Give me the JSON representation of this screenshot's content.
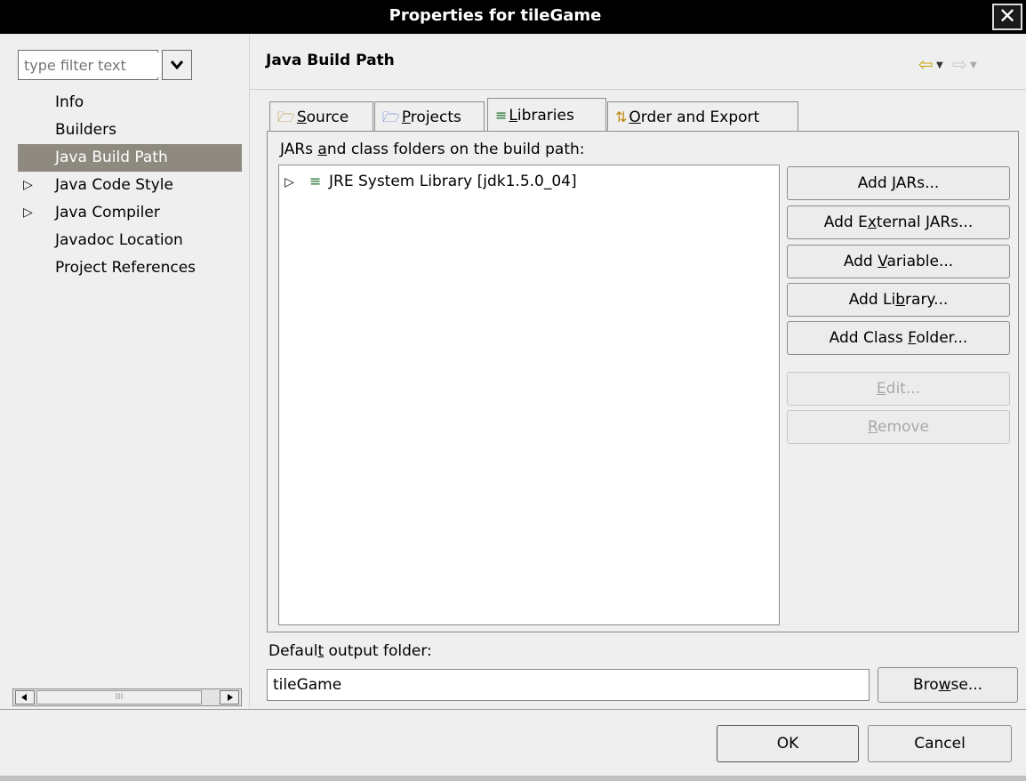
{
  "window": {
    "title": "Properties for tileGame",
    "close_glyph": "✕"
  },
  "filter": {
    "placeholder": "type filter text"
  },
  "nav": {
    "items": [
      {
        "label": "Info",
        "expandable": false,
        "selected": false
      },
      {
        "label": "Builders",
        "expandable": false,
        "selected": false
      },
      {
        "label": "Java Build Path",
        "expandable": false,
        "selected": true
      },
      {
        "label": "Java Code Style",
        "expandable": true,
        "selected": false
      },
      {
        "label": "Java Compiler",
        "expandable": true,
        "selected": false
      },
      {
        "label": "Javadoc Location",
        "expandable": false,
        "selected": false
      },
      {
        "label": "Project References",
        "expandable": false,
        "selected": false
      }
    ]
  },
  "page": {
    "title": "Java Build Path"
  },
  "tabs": [
    {
      "pre": "",
      "mn": "S",
      "post": "ource",
      "icon": "source-folder-icon",
      "active": false
    },
    {
      "pre": "",
      "mn": "P",
      "post": "rojects",
      "icon": "projects-folder-icon",
      "active": false
    },
    {
      "pre": "",
      "mn": "L",
      "post": "ibraries",
      "icon": "library-icon",
      "active": true
    },
    {
      "pre": "",
      "mn": "O",
      "post": "rder and Export",
      "icon": "order-export-icon",
      "active": false
    }
  ],
  "libraries": {
    "label_pre": "JARs ",
    "label_mn": "a",
    "label_post": "nd class folders on the build path:",
    "entries": [
      {
        "label": "JRE System Library [jdk1.5.0_04]",
        "icon": "library-icon"
      }
    ]
  },
  "buttons": [
    {
      "name": "add-jars-button",
      "pre": "Add ",
      "mn": "J",
      "post": "ARs...",
      "enabled": true
    },
    {
      "name": "add-external-jars-button",
      "pre": "Add E",
      "mn": "x",
      "post": "ternal JARs...",
      "enabled": true
    },
    {
      "name": "add-variable-button",
      "pre": "Add ",
      "mn": "V",
      "post": "ariable...",
      "enabled": true
    },
    {
      "name": "add-library-button",
      "pre": "Add Li",
      "mn": "b",
      "post": "rary...",
      "enabled": true
    },
    {
      "name": "add-class-folder-button",
      "pre": "Add Class ",
      "mn": "F",
      "post": "older...",
      "enabled": true
    },
    {
      "name": "edit-button",
      "pre": "",
      "mn": "E",
      "post": "dit...",
      "enabled": false
    },
    {
      "name": "remove-button",
      "pre": "",
      "mn": "R",
      "post": "emove",
      "enabled": false
    }
  ],
  "output": {
    "label_pre": "Defaul",
    "label_mn": "t",
    "label_post": " output folder:",
    "value": "tileGame"
  },
  "browse": {
    "pre": "Bro",
    "mn": "w",
    "post": "se..."
  },
  "footer": {
    "ok_label": "OK",
    "cancel_label": "Cancel"
  },
  "scrollbar": {
    "thumb_glyph": "III"
  }
}
